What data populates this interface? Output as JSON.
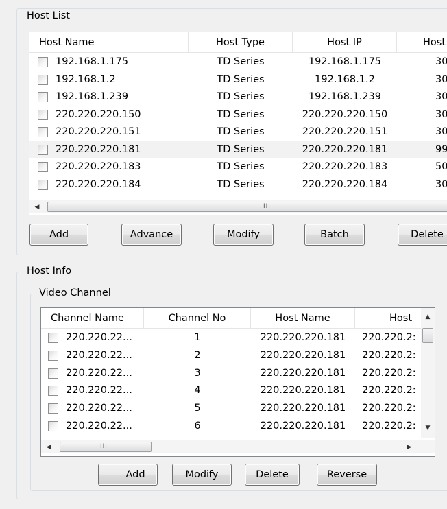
{
  "host_list": {
    "title": "Host List",
    "columns": [
      "Host Name",
      "Host Type",
      "Host IP",
      "Host"
    ],
    "rows": [
      {
        "name": "192.168.1.175",
        "type": "TD Series",
        "ip": "192.168.1.175",
        "extra": "30"
      },
      {
        "name": "192.168.1.2",
        "type": "TD Series",
        "ip": "192.168.1.2",
        "extra": "30"
      },
      {
        "name": "192.168.1.239",
        "type": "TD Series",
        "ip": "192.168.1.239",
        "extra": "30"
      },
      {
        "name": "220.220.220.150",
        "type": "TD Series",
        "ip": "220.220.220.150",
        "extra": "30"
      },
      {
        "name": "220.220.220.151",
        "type": "TD Series",
        "ip": "220.220.220.151",
        "extra": "30"
      },
      {
        "name": "220.220.220.181",
        "type": "TD Series",
        "ip": "220.220.220.181",
        "extra": "99"
      },
      {
        "name": "220.220.220.183",
        "type": "TD Series",
        "ip": "220.220.220.183",
        "extra": "50"
      },
      {
        "name": "220.220.220.184",
        "type": "TD Series",
        "ip": "220.220.220.184",
        "extra": "30"
      }
    ],
    "grip": "III",
    "buttons": {
      "add": "Add",
      "advance": "Advance",
      "modify": "Modify",
      "batch": "Batch",
      "delete": "Delete"
    }
  },
  "host_info": {
    "title": "Host Info",
    "video_channel": {
      "title": "Video Channel",
      "columns": [
        "Channel Name",
        "Channel No",
        "Host Name",
        "Host"
      ],
      "rows": [
        {
          "channel": "220.220.22...",
          "no": "1",
          "host": "220.220.220.181",
          "extra": "220.220.2:"
        },
        {
          "channel": "220.220.22...",
          "no": "2",
          "host": "220.220.220.181",
          "extra": "220.220.2:"
        },
        {
          "channel": "220.220.22...",
          "no": "3",
          "host": "220.220.220.181",
          "extra": "220.220.2:"
        },
        {
          "channel": "220.220.22...",
          "no": "4",
          "host": "220.220.220.181",
          "extra": "220.220.2:"
        },
        {
          "channel": "220.220.22...",
          "no": "5",
          "host": "220.220.220.181",
          "extra": "220.220.2:"
        },
        {
          "channel": "220.220.22...",
          "no": "6",
          "host": "220.220.220.181",
          "extra": "220.220.2:"
        }
      ],
      "grip": "III"
    },
    "buttons": {
      "add": "Add",
      "modify": "Modify",
      "delete": "Delete",
      "reverse": "Reverse"
    }
  },
  "icons": {
    "left_arrow": "◀",
    "right_arrow": "▶",
    "up_arrow": "▲",
    "down_arrow": "▼"
  },
  "colors": {
    "group_border": "#d5dfe5",
    "list_border": "#828790",
    "highlight_row": "#f2f2f2"
  }
}
